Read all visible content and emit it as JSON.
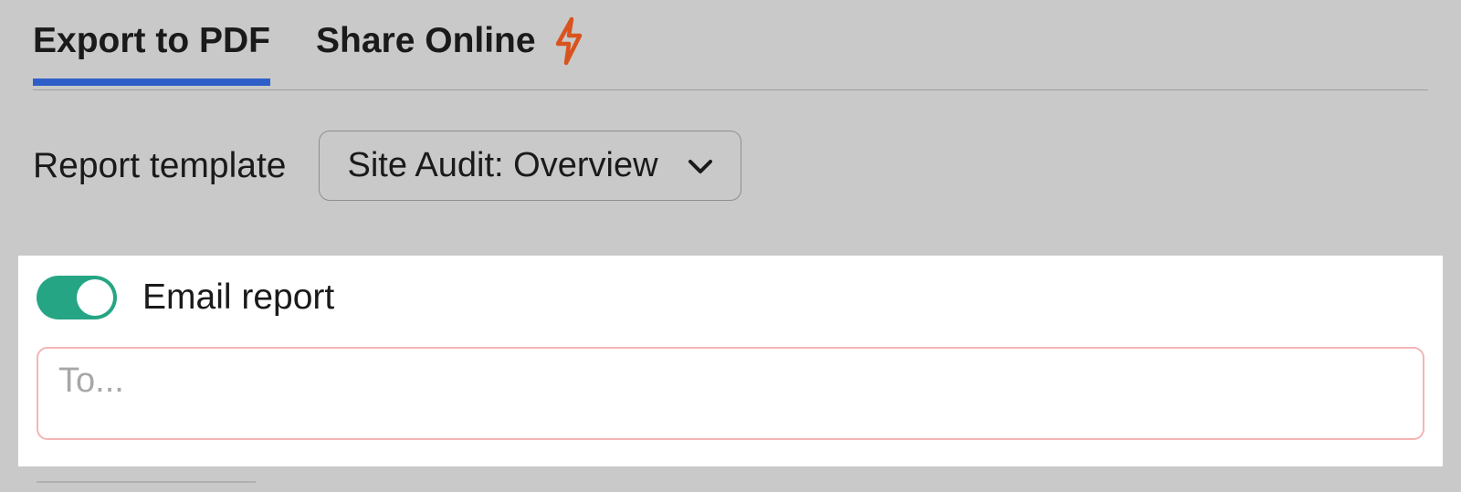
{
  "tabs": {
    "export_pdf": "Export to PDF",
    "share_online": "Share Online"
  },
  "template": {
    "label": "Report template",
    "selected": "Site Audit: Overview"
  },
  "email": {
    "toggle_label": "Email report",
    "placeholder": "To..."
  }
}
